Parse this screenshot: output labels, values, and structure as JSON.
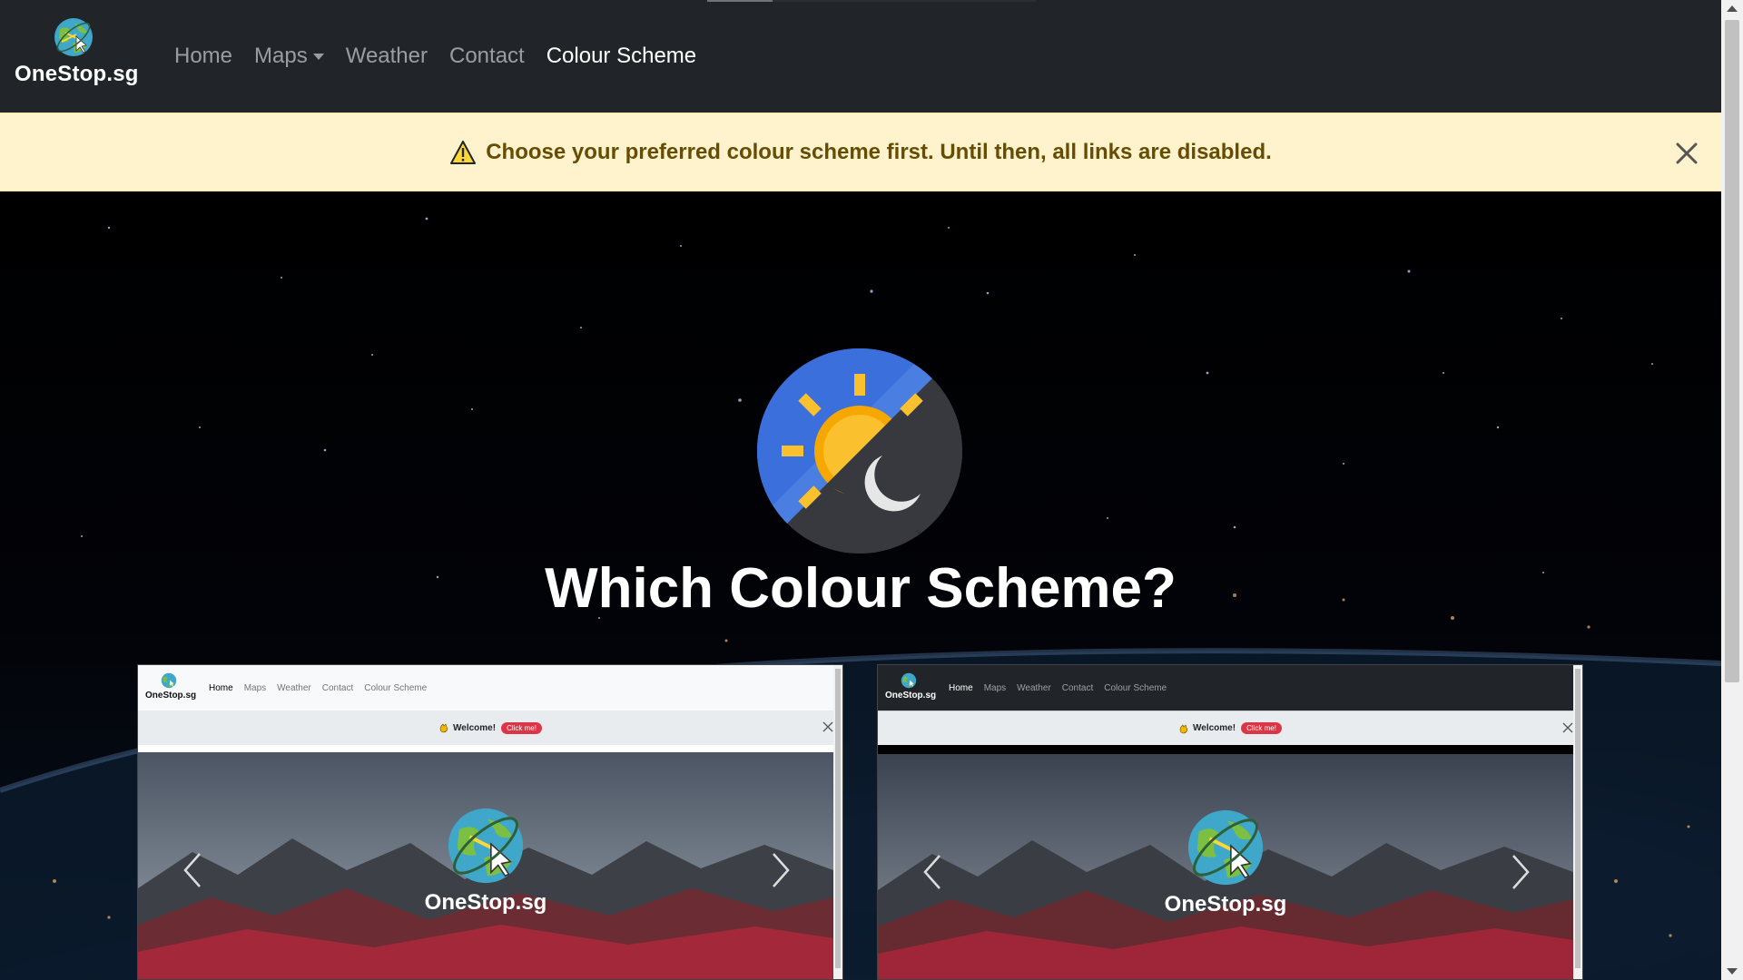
{
  "navbar": {
    "brand_name": "OneStop.sg",
    "links": [
      {
        "label": "Home"
      },
      {
        "label": "Maps"
      },
      {
        "label": "Weather"
      },
      {
        "label": "Contact"
      },
      {
        "label": "Colour Scheme"
      }
    ],
    "active_link": "Colour Scheme"
  },
  "alert": {
    "message": "Choose your preferred colour scheme first. Until then, all links are disabled.",
    "icon": "warning-triangle-icon"
  },
  "hero": {
    "title": "Which Colour Scheme?",
    "icon": "day-night-icon"
  },
  "previews": {
    "light": {
      "brand_name": "OneStop.sg",
      "links": [
        "Home",
        "Maps",
        "Weather",
        "Contact",
        "Colour Scheme"
      ],
      "welcome": "Welcome!",
      "button": "Click me!",
      "hero_name": "OneStop.sg"
    },
    "dark": {
      "brand_name": "OneStop.sg",
      "links": [
        "Home",
        "Maps",
        "Weather",
        "Contact",
        "Colour Scheme"
      ],
      "welcome": "Welcome!",
      "button": "Click me!",
      "hero_name": "OneStop.sg"
    }
  },
  "colors": {
    "navbar_bg": "#212529",
    "alert_bg": "#fff3cd",
    "alert_text": "#664d03",
    "accent_red": "#dc3545"
  }
}
